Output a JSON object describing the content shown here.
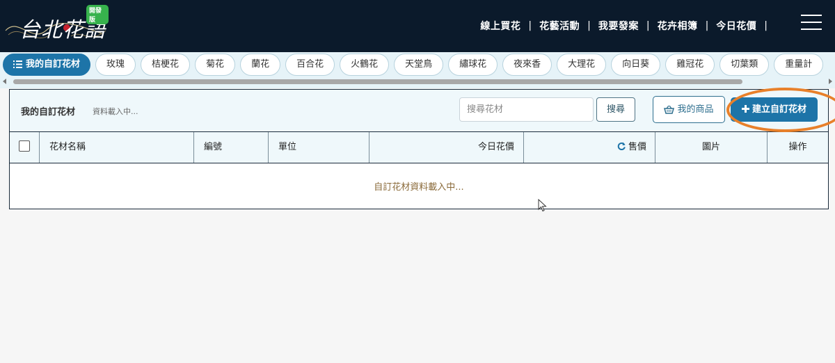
{
  "header": {
    "logo_text": "台北花語",
    "logo_badge": "開發版",
    "nav": [
      "線上買花",
      "花藝活動",
      "我要發案",
      "花卉相簿",
      "今日花價"
    ],
    "nav_separator": "|",
    "menu_icon": "hamburger-menu-icon"
  },
  "categories": {
    "active": "我的自訂花材",
    "items": [
      "玫瑰",
      "桔梗花",
      "菊花",
      "蘭花",
      "百合花",
      "火鶴花",
      "天堂鳥",
      "繡球花",
      "夜來香",
      "大理花",
      "向日葵",
      "雞冠花",
      "切葉類",
      "重量計"
    ]
  },
  "panel": {
    "title": "我的自訂花材",
    "status": "資料載入中...",
    "search_placeholder": "搜尋花材",
    "search_button": "搜尋",
    "my_products_button": "我的商品",
    "create_button": "建立自訂花材"
  },
  "table": {
    "columns": {
      "name": "花材名稱",
      "code": "編號",
      "unit": "單位",
      "today_price": "今日花價",
      "sale_price": "售價",
      "image": "圖片",
      "action": "操作"
    },
    "loading_message": "自訂花材資料載入中..."
  },
  "colors": {
    "header_bg": "#0b1a2b",
    "accent": "#1d74a8",
    "highlight": "#e8802a"
  }
}
